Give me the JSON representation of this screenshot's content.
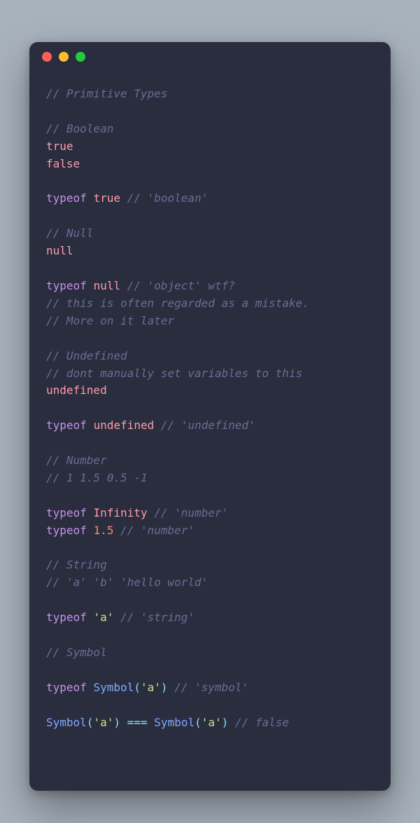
{
  "colors": {
    "windowBg": "#292d3e",
    "red": "#ff5f56",
    "yellow": "#ffbd2e",
    "green": "#27c93f"
  },
  "lines": [
    [
      {
        "t": "// Primitive Types",
        "c": "comment"
      }
    ],
    [],
    [
      {
        "t": "// Boolean",
        "c": "comment"
      }
    ],
    [
      {
        "t": "true",
        "c": "const"
      }
    ],
    [
      {
        "t": "false",
        "c": "const"
      }
    ],
    [],
    [
      {
        "t": "typeof",
        "c": "keyword"
      },
      {
        "t": " ",
        "c": "default"
      },
      {
        "t": "true",
        "c": "const"
      },
      {
        "t": " ",
        "c": "default"
      },
      {
        "t": "// 'boolean'",
        "c": "comment"
      }
    ],
    [],
    [
      {
        "t": "// Null",
        "c": "comment"
      }
    ],
    [
      {
        "t": "null",
        "c": "const"
      }
    ],
    [],
    [
      {
        "t": "typeof",
        "c": "keyword"
      },
      {
        "t": " ",
        "c": "default"
      },
      {
        "t": "null",
        "c": "const"
      },
      {
        "t": " ",
        "c": "default"
      },
      {
        "t": "// 'object' wtf?",
        "c": "comment"
      }
    ],
    [
      {
        "t": "// this is often regarded as a mistake.",
        "c": "comment"
      }
    ],
    [
      {
        "t": "// More on it later",
        "c": "comment"
      }
    ],
    [],
    [
      {
        "t": "// Undefined",
        "c": "comment"
      }
    ],
    [
      {
        "t": "// dont manually set variables to this",
        "c": "comment"
      }
    ],
    [
      {
        "t": "undefined",
        "c": "const"
      }
    ],
    [],
    [
      {
        "t": "typeof",
        "c": "keyword"
      },
      {
        "t": " ",
        "c": "default"
      },
      {
        "t": "undefined",
        "c": "const"
      },
      {
        "t": " ",
        "c": "default"
      },
      {
        "t": "// 'undefined'",
        "c": "comment"
      }
    ],
    [],
    [
      {
        "t": "// Number",
        "c": "comment"
      }
    ],
    [
      {
        "t": "// 1 1.5 0.5 -1",
        "c": "comment"
      }
    ],
    [],
    [
      {
        "t": "typeof",
        "c": "keyword"
      },
      {
        "t": " ",
        "c": "default"
      },
      {
        "t": "Infinity",
        "c": "const"
      },
      {
        "t": " ",
        "c": "default"
      },
      {
        "t": "// 'number'",
        "c": "comment"
      }
    ],
    [
      {
        "t": "typeof",
        "c": "keyword"
      },
      {
        "t": " ",
        "c": "default"
      },
      {
        "t": "1.5",
        "c": "number"
      },
      {
        "t": " ",
        "c": "default"
      },
      {
        "t": "// 'number'",
        "c": "comment"
      }
    ],
    [],
    [
      {
        "t": "// String",
        "c": "comment"
      }
    ],
    [
      {
        "t": "// 'a' 'b' 'hello world'",
        "c": "comment"
      }
    ],
    [],
    [
      {
        "t": "typeof",
        "c": "keyword"
      },
      {
        "t": " ",
        "c": "default"
      },
      {
        "t": "'a'",
        "c": "string"
      },
      {
        "t": " ",
        "c": "default"
      },
      {
        "t": "// 'string'",
        "c": "comment"
      }
    ],
    [],
    [
      {
        "t": "// Symbol",
        "c": "comment"
      }
    ],
    [],
    [
      {
        "t": "typeof",
        "c": "keyword"
      },
      {
        "t": " ",
        "c": "default"
      },
      {
        "t": "Symbol",
        "c": "func"
      },
      {
        "t": "(",
        "c": "paren"
      },
      {
        "t": "'a'",
        "c": "string"
      },
      {
        "t": ")",
        "c": "paren"
      },
      {
        "t": " ",
        "c": "default"
      },
      {
        "t": "// 'symbol'",
        "c": "comment"
      }
    ],
    [],
    [
      {
        "t": "Symbol",
        "c": "func"
      },
      {
        "t": "(",
        "c": "paren"
      },
      {
        "t": "'a'",
        "c": "string"
      },
      {
        "t": ")",
        "c": "paren"
      },
      {
        "t": " ",
        "c": "default"
      },
      {
        "t": "===",
        "c": "operator"
      },
      {
        "t": " ",
        "c": "default"
      },
      {
        "t": "Symbol",
        "c": "func"
      },
      {
        "t": "(",
        "c": "paren"
      },
      {
        "t": "'a'",
        "c": "string"
      },
      {
        "t": ")",
        "c": "paren"
      },
      {
        "t": " ",
        "c": "default"
      },
      {
        "t": "// false",
        "c": "comment"
      }
    ]
  ]
}
